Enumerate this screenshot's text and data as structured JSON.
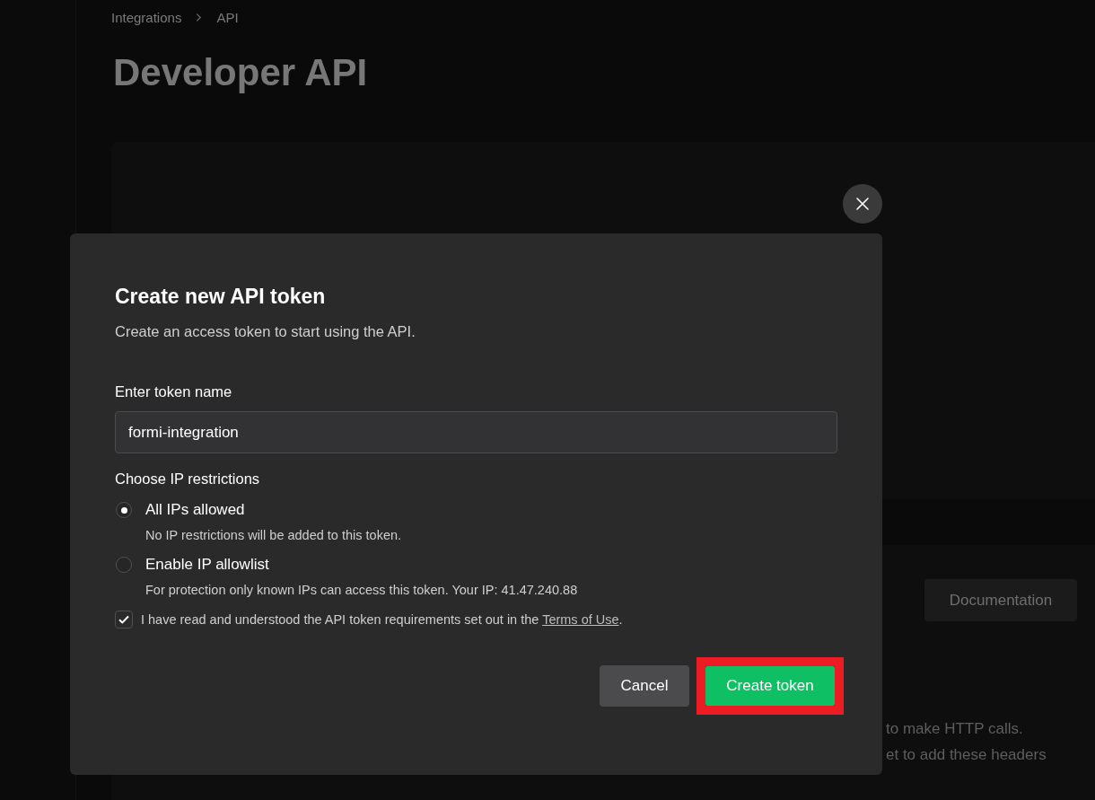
{
  "breadcrumb": [
    {
      "label": "Integrations"
    },
    {
      "label": "API"
    }
  ],
  "page_title": "Developer API",
  "documentation_button": {
    "label": "Documentation"
  },
  "background_text": [
    "to make HTTP calls.",
    "et to add these headers"
  ],
  "dialog": {
    "title": "Create new API token",
    "subtitle": "Create an access token to start using the API.",
    "token_name_field": {
      "label": "Enter token name",
      "value": "formi-integration"
    },
    "ip_restrictions": {
      "label": "Choose IP restrictions",
      "options": [
        {
          "label": "All IPs allowed",
          "description": "No IP restrictions will be added to this token.",
          "selected": true
        },
        {
          "label": "Enable IP allowlist",
          "description": "For protection only known IPs can access this token. Your IP: 41.47.240.88",
          "selected": false
        }
      ]
    },
    "terms": {
      "checked": true,
      "text": "I have read and understood the API token requirements set out in the ",
      "link": "Terms of Use",
      "suffix": "."
    },
    "buttons": [
      {
        "label": "Cancel",
        "kind": "secondary",
        "highlighted": false
      },
      {
        "label": "Create token",
        "kind": "primary",
        "highlighted": true
      }
    ]
  }
}
